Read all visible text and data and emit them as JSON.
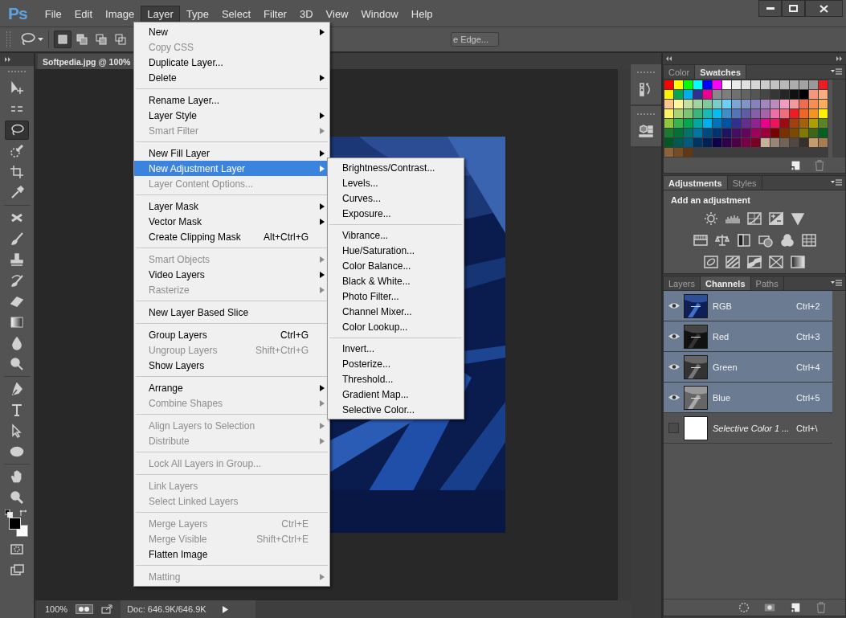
{
  "app": {
    "logo": "Ps"
  },
  "menubar": [
    {
      "label": "File",
      "selected": false
    },
    {
      "label": "Edit",
      "selected": false
    },
    {
      "label": "Image",
      "selected": false
    },
    {
      "label": "Layer",
      "selected": true
    },
    {
      "label": "Type",
      "selected": false
    },
    {
      "label": "Select",
      "selected": false
    },
    {
      "label": "Filter",
      "selected": false
    },
    {
      "label": "3D",
      "selected": false
    },
    {
      "label": "View",
      "selected": false
    },
    {
      "label": "Window",
      "selected": false
    },
    {
      "label": "Help",
      "selected": false
    }
  ],
  "options_bar": {
    "modes": [
      {
        "selected": true
      },
      {
        "selected": false
      },
      {
        "selected": false
      },
      {
        "selected": false
      }
    ],
    "refine_button": "e Edge..."
  },
  "tools": [
    [
      {
        "selected": false
      },
      {
        "selected": false
      },
      {
        "selected": true
      },
      {
        "selected": false
      },
      {
        "selected": false
      },
      {
        "selected": false
      }
    ],
    [
      {
        "selected": false
      },
      {
        "selected": false
      },
      {
        "selected": false
      },
      {
        "selected": false
      },
      {
        "selected": false
      },
      {
        "selected": false
      },
      {
        "selected": false
      },
      {
        "selected": false
      }
    ],
    [
      {
        "selected": false
      },
      {
        "selected": false
      },
      {
        "selected": false
      },
      {
        "selected": false
      }
    ],
    [
      {
        "selected": false
      },
      {
        "selected": false
      }
    ]
  ],
  "document": {
    "tab": "Softpedia.jpg @ 100%",
    "zoom": "100%",
    "doc_info": "Doc: 646.9K/646.9K"
  },
  "layer_menu": {
    "groups": [
      [
        {
          "label": "New",
          "submenu": true,
          "disabled": false,
          "selected": false
        },
        {
          "label": "Copy CSS",
          "submenu": false,
          "disabled": true,
          "selected": false
        },
        {
          "label": "Duplicate Layer...",
          "submenu": false,
          "disabled": false,
          "selected": false
        },
        {
          "label": "Delete",
          "submenu": true,
          "disabled": false,
          "selected": false
        }
      ],
      [
        {
          "label": "Rename Layer...",
          "submenu": false,
          "disabled": false,
          "selected": false
        },
        {
          "label": "Layer Style",
          "submenu": true,
          "disabled": false,
          "selected": false
        },
        {
          "label": "Smart Filter",
          "submenu": true,
          "disabled": true,
          "selected": false
        }
      ],
      [
        {
          "label": "New Fill Layer",
          "submenu": true,
          "disabled": false,
          "selected": false
        },
        {
          "label": "New Adjustment Layer",
          "submenu": true,
          "disabled": false,
          "selected": true
        },
        {
          "label": "Layer Content Options...",
          "submenu": false,
          "disabled": true,
          "selected": false
        }
      ],
      [
        {
          "label": "Layer Mask",
          "submenu": true,
          "disabled": false,
          "selected": false
        },
        {
          "label": "Vector Mask",
          "submenu": true,
          "disabled": false,
          "selected": false
        },
        {
          "label": "Create Clipping Mask",
          "shortcut": "Alt+Ctrl+G",
          "submenu": false,
          "disabled": false,
          "selected": false
        }
      ],
      [
        {
          "label": "Smart Objects",
          "submenu": true,
          "disabled": true,
          "selected": false
        },
        {
          "label": "Video Layers",
          "submenu": true,
          "disabled": false,
          "selected": false
        },
        {
          "label": "Rasterize",
          "submenu": true,
          "disabled": true,
          "selected": false
        }
      ],
      [
        {
          "label": "New Layer Based Slice",
          "submenu": false,
          "disabled": false,
          "selected": false
        }
      ],
      [
        {
          "label": "Group Layers",
          "shortcut": "Ctrl+G",
          "submenu": false,
          "disabled": false,
          "selected": false
        },
        {
          "label": "Ungroup Layers",
          "shortcut": "Shift+Ctrl+G",
          "submenu": false,
          "disabled": true,
          "selected": false
        },
        {
          "label": "Show Layers",
          "submenu": false,
          "disabled": false,
          "selected": false
        }
      ],
      [
        {
          "label": "Arrange",
          "submenu": true,
          "disabled": false,
          "selected": false
        },
        {
          "label": "Combine Shapes",
          "submenu": true,
          "disabled": true,
          "selected": false
        }
      ],
      [
        {
          "label": "Align Layers to Selection",
          "submenu": true,
          "disabled": true,
          "selected": false
        },
        {
          "label": "Distribute",
          "submenu": true,
          "disabled": true,
          "selected": false
        }
      ],
      [
        {
          "label": "Lock All Layers in Group...",
          "submenu": false,
          "disabled": true,
          "selected": false
        }
      ],
      [
        {
          "label": "Link Layers",
          "submenu": false,
          "disabled": true,
          "selected": false
        },
        {
          "label": "Select Linked Layers",
          "submenu": false,
          "disabled": true,
          "selected": false
        }
      ],
      [
        {
          "label": "Merge Layers",
          "shortcut": "Ctrl+E",
          "submenu": false,
          "disabled": true,
          "selected": false
        },
        {
          "label": "Merge Visible",
          "shortcut": "Shift+Ctrl+E",
          "submenu": false,
          "disabled": true,
          "selected": false
        },
        {
          "label": "Flatten Image",
          "submenu": false,
          "disabled": false,
          "selected": false
        }
      ],
      [
        {
          "label": "Matting",
          "submenu": true,
          "disabled": true,
          "selected": false
        }
      ]
    ]
  },
  "adjustment_submenu": {
    "groups": [
      [
        {
          "label": "Brightness/Contrast..."
        },
        {
          "label": "Levels..."
        },
        {
          "label": "Curves..."
        },
        {
          "label": "Exposure..."
        }
      ],
      [
        {
          "label": "Vibrance..."
        },
        {
          "label": "Hue/Saturation..."
        },
        {
          "label": "Color Balance..."
        },
        {
          "label": "Black & White..."
        },
        {
          "label": "Photo Filter..."
        },
        {
          "label": "Channel Mixer..."
        },
        {
          "label": "Color Lookup..."
        }
      ],
      [
        {
          "label": "Invert..."
        },
        {
          "label": "Posterize..."
        },
        {
          "label": "Threshold..."
        },
        {
          "label": "Gradient Map..."
        },
        {
          "label": "Selective Color..."
        }
      ]
    ]
  },
  "swatches_panel": {
    "tabs": [
      {
        "label": "Color",
        "selected": false
      },
      {
        "label": "Swatches",
        "selected": true
      }
    ],
    "swatches": [
      {
        "color": "#ff0000"
      },
      {
        "color": "#ffff00"
      },
      {
        "color": "#00ff00"
      },
      {
        "color": "#00ffff"
      },
      {
        "color": "#0000ff"
      },
      {
        "color": "#ff00ff"
      },
      {
        "color": "#ffffff"
      },
      {
        "color": "#ebebeb"
      },
      {
        "color": "#e0e0e0"
      },
      {
        "color": "#d6d6d6"
      },
      {
        "color": "#cccccc"
      },
      {
        "color": "#c2c2c2"
      },
      {
        "color": "#b8b8b8"
      },
      {
        "color": "#adadad"
      },
      {
        "color": "#a3a3a3"
      },
      {
        "color": "#999999"
      },
      {
        "color": "#ed1c24"
      },
      {
        "color": "#fff200"
      },
      {
        "color": "#00a651"
      },
      {
        "color": "#00aeef"
      },
      {
        "color": "#2e3192"
      },
      {
        "color": "#ec008c"
      },
      {
        "color": "#898989"
      },
      {
        "color": "#7d7d7d"
      },
      {
        "color": "#707070"
      },
      {
        "color": "#636363"
      },
      {
        "color": "#555555"
      },
      {
        "color": "#464646"
      },
      {
        "color": "#363636"
      },
      {
        "color": "#262626"
      },
      {
        "color": "#111111"
      },
      {
        "color": "#000000"
      },
      {
        "color": "#f7977a"
      },
      {
        "color": "#fbad82"
      },
      {
        "color": "#fdc68c"
      },
      {
        "color": "#fff799"
      },
      {
        "color": "#c6df9c"
      },
      {
        "color": "#a4d49d"
      },
      {
        "color": "#81ca9d"
      },
      {
        "color": "#7bcdc9"
      },
      {
        "color": "#6ccff7"
      },
      {
        "color": "#7ca6d8"
      },
      {
        "color": "#8293ca"
      },
      {
        "color": "#8881be"
      },
      {
        "color": "#a286bd"
      },
      {
        "color": "#bc8cbf"
      },
      {
        "color": "#f49bc1"
      },
      {
        "color": "#f5999d"
      },
      {
        "color": "#f16c4d"
      },
      {
        "color": "#f68e56"
      },
      {
        "color": "#fbaf5a"
      },
      {
        "color": "#fff467"
      },
      {
        "color": "#acd372"
      },
      {
        "color": "#7dc473"
      },
      {
        "color": "#39b778"
      },
      {
        "color": "#16bcb4"
      },
      {
        "color": "#00bff3"
      },
      {
        "color": "#438ccb"
      },
      {
        "color": "#5573b7"
      },
      {
        "color": "#5e5ca7"
      },
      {
        "color": "#855fa8"
      },
      {
        "color": "#a763a9"
      },
      {
        "color": "#ef6ea8"
      },
      {
        "color": "#f16d7e"
      },
      {
        "color": "#ee1d24"
      },
      {
        "color": "#f16522"
      },
      {
        "color": "#f7941d"
      },
      {
        "color": "#fff100"
      },
      {
        "color": "#8fc63d"
      },
      {
        "color": "#37b44a"
      },
      {
        "color": "#00a650"
      },
      {
        "color": "#00a99e"
      },
      {
        "color": "#00aeef"
      },
      {
        "color": "#0072bc"
      },
      {
        "color": "#0054a5"
      },
      {
        "color": "#2f3090"
      },
      {
        "color": "#662d91"
      },
      {
        "color": "#912491"
      },
      {
        "color": "#eb008b"
      },
      {
        "color": "#ed145b"
      },
      {
        "color": "#9d0a0f"
      },
      {
        "color": "#a1410d"
      },
      {
        "color": "#a36209"
      },
      {
        "color": "#aba000"
      },
      {
        "color": "#598527"
      },
      {
        "color": "#1a7b30"
      },
      {
        "color": "#007236"
      },
      {
        "color": "#00736a"
      },
      {
        "color": "#0076a4"
      },
      {
        "color": "#004a80"
      },
      {
        "color": "#003370"
      },
      {
        "color": "#1d1363"
      },
      {
        "color": "#450e61"
      },
      {
        "color": "#62055f"
      },
      {
        "color": "#9e005c"
      },
      {
        "color": "#9d0039"
      },
      {
        "color": "#790000"
      },
      {
        "color": "#7b3000"
      },
      {
        "color": "#7c4900"
      },
      {
        "color": "#827a00"
      },
      {
        "color": "#3e6617"
      },
      {
        "color": "#045f20"
      },
      {
        "color": "#005826"
      },
      {
        "color": "#005952"
      },
      {
        "color": "#005b7e"
      },
      {
        "color": "#003562"
      },
      {
        "color": "#002056"
      },
      {
        "color": "#0c004b"
      },
      {
        "color": "#30004a"
      },
      {
        "color": "#4b0048"
      },
      {
        "color": "#7a0045"
      },
      {
        "color": "#7a0026"
      },
      {
        "color": "#c7b299"
      },
      {
        "color": "#998675"
      },
      {
        "color": "#736357"
      },
      {
        "color": "#534741"
      },
      {
        "color": "#372f2a"
      },
      {
        "color": "#c69c6d"
      },
      {
        "color": "#a77c50"
      },
      {
        "color": "#8c6239"
      },
      {
        "color": "#754c24"
      },
      {
        "color": "#603913"
      }
    ]
  },
  "adjustments_panel": {
    "tabs": [
      {
        "label": "Adjustments",
        "selected": true
      },
      {
        "label": "Styles",
        "selected": false
      }
    ],
    "heading": "Add an adjustment"
  },
  "channels_panel": {
    "tabs": [
      {
        "label": "Layers",
        "selected": false
      },
      {
        "label": "Channels",
        "selected": true
      },
      {
        "label": "Paths",
        "selected": false
      }
    ],
    "channels": [
      {
        "kind": "composite",
        "name": "RGB",
        "shortcut": "Ctrl+2",
        "visible": true,
        "selected": true
      },
      {
        "kind": "channel",
        "name": "Red",
        "shortcut": "Ctrl+3",
        "visible": true,
        "selected": true
      },
      {
        "kind": "channel",
        "name": "Green",
        "shortcut": "Ctrl+4",
        "visible": true,
        "selected": true
      },
      {
        "kind": "channel",
        "name": "Blue",
        "shortcut": "Ctrl+5",
        "visible": true,
        "selected": true
      },
      {
        "kind": "mask",
        "name": "Selective Color 1 ...",
        "shortcut": "Ctrl+\\",
        "visible": false,
        "selected": false
      }
    ]
  }
}
